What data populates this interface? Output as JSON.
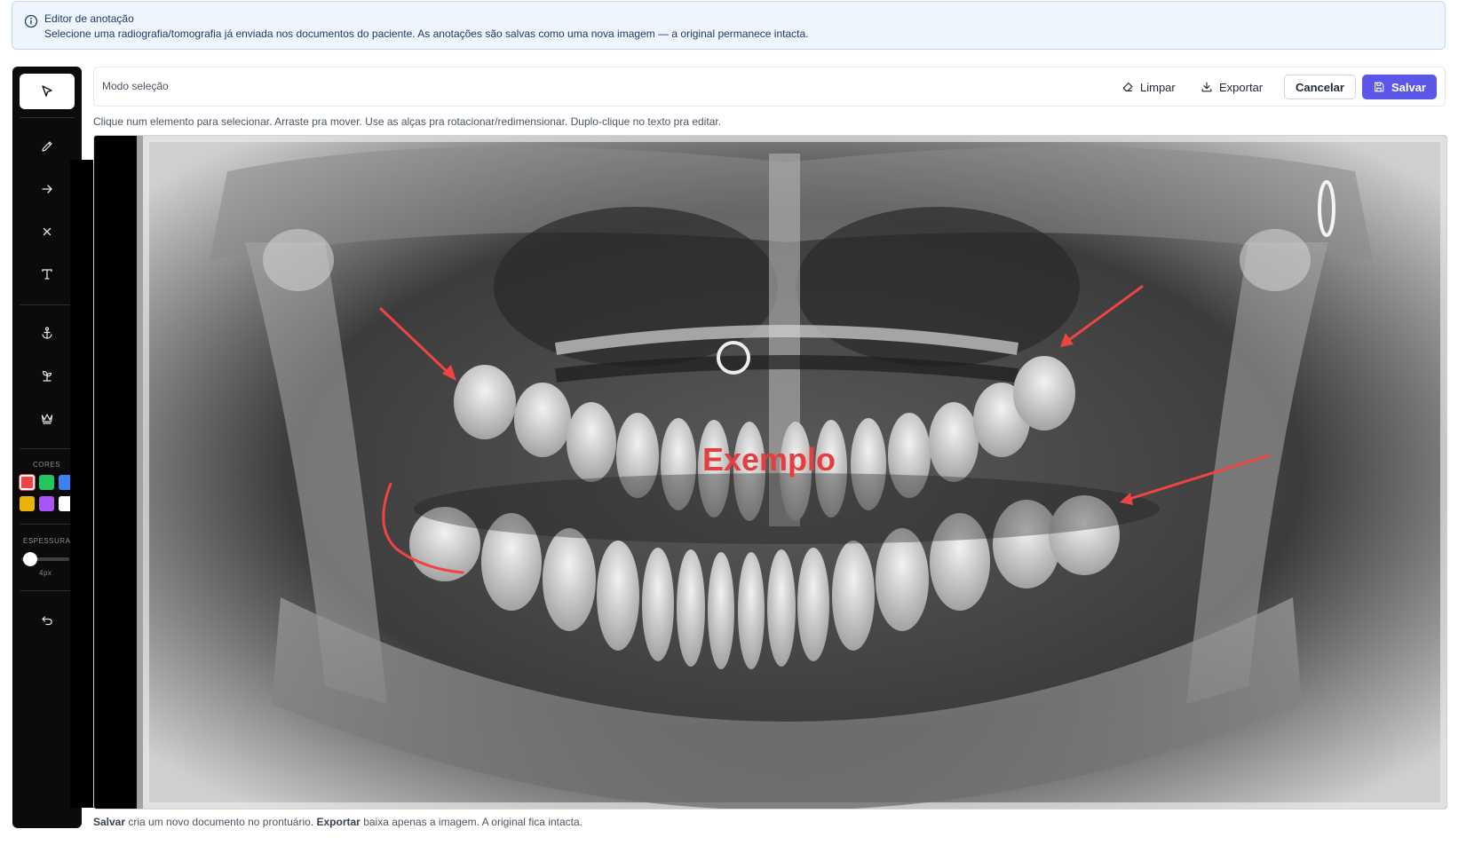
{
  "banner": {
    "title": "Editor de anotação",
    "text": "Selecione uma radiografia/tomografia já enviada nos documentos do paciente. As anotações são salvas como uma nova imagem — a original permanece intacta."
  },
  "tools": [
    {
      "name": "select-tool",
      "icon": "cursor-arrow-icon",
      "active": true
    },
    {
      "name": "pencil-tool",
      "icon": "pencil-icon"
    },
    {
      "name": "arrow-tool",
      "icon": "arrow-right-icon"
    },
    {
      "name": "x-mark-tool",
      "icon": "x-icon"
    },
    {
      "name": "text-tool",
      "icon": "text-icon"
    },
    {
      "name": "implant-tool",
      "icon": "anchor-icon"
    },
    {
      "name": "root-tool",
      "icon": "sprout-icon"
    },
    {
      "name": "crown-tool",
      "icon": "crown-icon"
    },
    {
      "name": "undo-tool",
      "icon": "undo-icon"
    }
  ],
  "colors": {
    "label": "CORES",
    "swatches": [
      "#ef4444",
      "#22c55e",
      "#3b82f6",
      "#eab308",
      "#a855f7",
      "#ffffff"
    ],
    "selected": "#ef4444"
  },
  "thickness": {
    "label": "ESPESSURA",
    "value_label": "4px"
  },
  "toolbar": {
    "mode_label": "Modo seleção",
    "clear_label": "Limpar",
    "export_label": "Exportar",
    "cancel_label": "Cancelar",
    "save_label": "Salvar"
  },
  "hint": "Clique num elemento para selecionar. Arraste pra mover. Use as alças pra rotacionar/redimensionar. Duplo-clique no texto pra editar.",
  "annotations": {
    "text": "Exemplo",
    "color": "#ef4444"
  },
  "footer": {
    "save_word": "Salvar",
    "save_text": " cria um novo documento no prontuário. ",
    "export_word": "Exportar",
    "export_text": " baixa apenas a imagem. A original fica intacta."
  },
  "colors_theme": {
    "accent": "#5b57e8",
    "banner_bg": "#eef5fd"
  }
}
